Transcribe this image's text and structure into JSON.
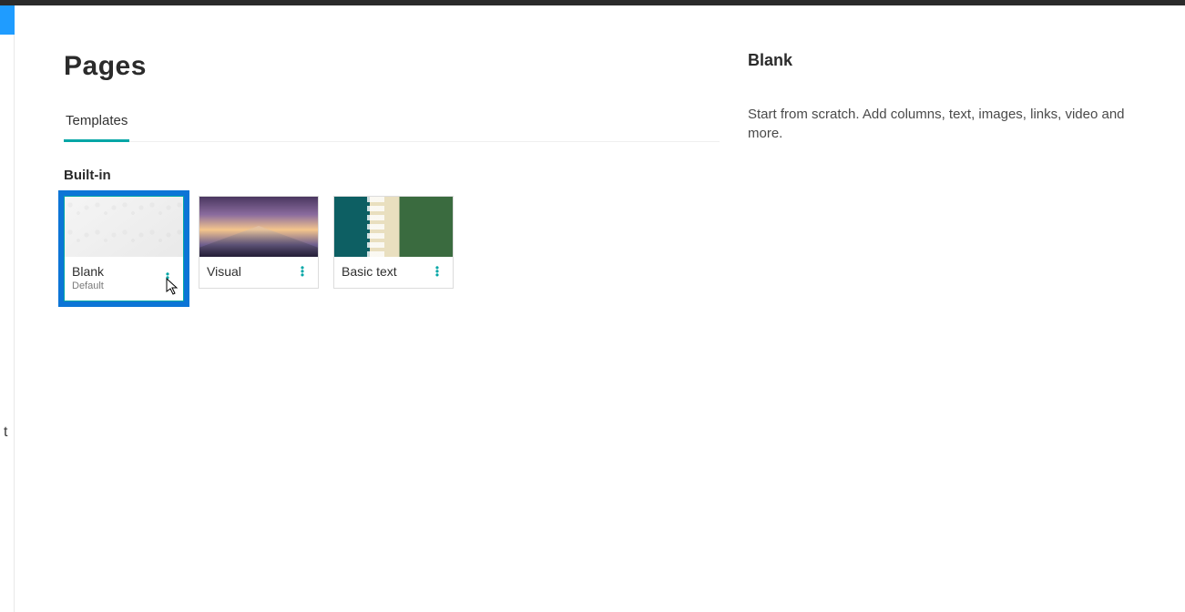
{
  "header": {
    "title": "Pages"
  },
  "tabs": [
    {
      "label": "Templates",
      "active": true
    }
  ],
  "section_builtin": {
    "heading": "Built-in"
  },
  "cards": [
    {
      "title": "Blank",
      "subtitle": "Default",
      "selected": true
    },
    {
      "title": "Visual",
      "subtitle": "",
      "selected": false
    },
    {
      "title": "Basic text",
      "subtitle": "",
      "selected": false
    }
  ],
  "details": {
    "title": "Blank",
    "description": "Start from scratch. Add columns, text, images, links, video and more."
  },
  "colors": {
    "accent": "#03a6a6",
    "selection": "#0c75d6",
    "top_accent": "#1f9cff"
  }
}
